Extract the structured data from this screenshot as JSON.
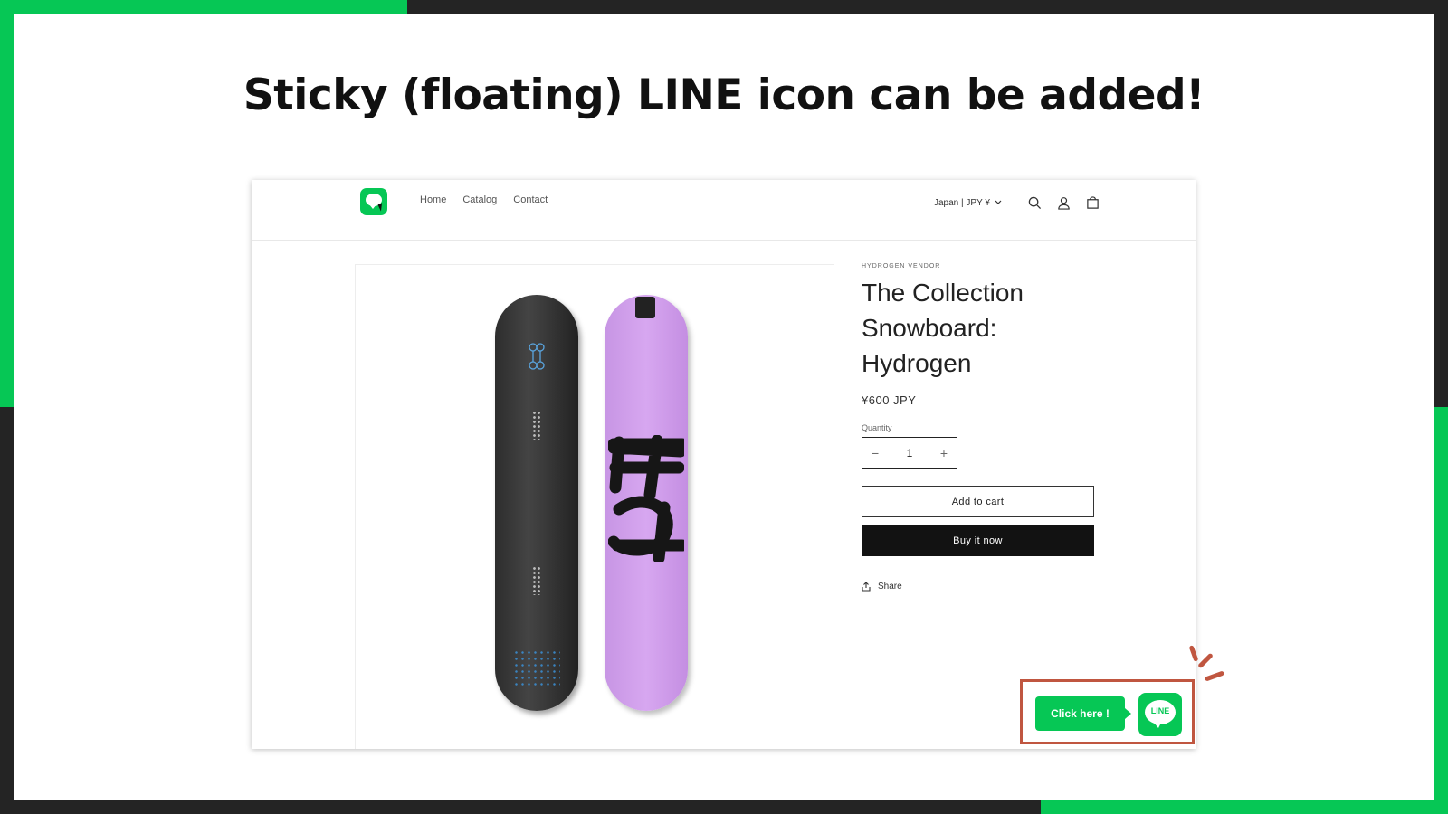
{
  "headline": "Sticky (floating) LINE icon can be added!",
  "store": {
    "nav": {
      "links": [
        "Home",
        "Catalog",
        "Contact"
      ],
      "locale": "Japan | JPY ¥"
    },
    "product": {
      "vendor": "HYDROGEN VENDOR",
      "title_lines": [
        "The Collection",
        "Snowboard:",
        "Hydrogen"
      ],
      "price": "¥600 JPY",
      "quantity_label": "Quantity",
      "quantity_value": "1",
      "add_to_cart": "Add to cart",
      "buy_now": "Buy it now",
      "share": "Share"
    }
  },
  "floating": {
    "callout": "Click here !",
    "line_label": "LINE"
  },
  "colors": {
    "line_green": "#06c755",
    "highlight": "#c05640",
    "background": "#242424"
  }
}
